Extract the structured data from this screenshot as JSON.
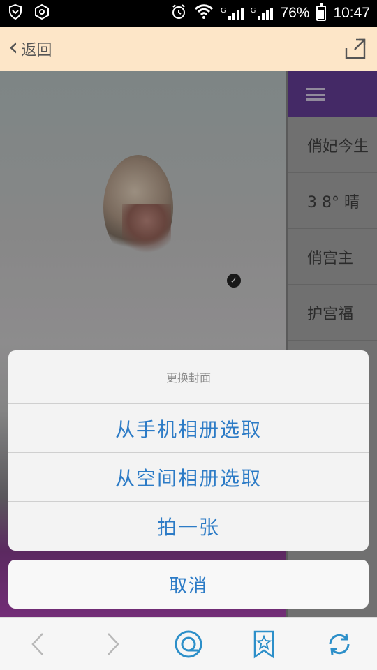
{
  "status_bar": {
    "signal_label_1": "G",
    "signal_label_2": "G",
    "battery": "76%",
    "time": "10:47"
  },
  "header": {
    "back_label": "返回",
    "share_icon": "share-icon"
  },
  "side_menu": {
    "items": [
      {
        "label": "俏妃今生"
      },
      {
        "label": "3 8° 晴"
      },
      {
        "label": "俏宫主"
      },
      {
        "label": "护宫福"
      }
    ]
  },
  "action_sheet": {
    "title": "更换封面",
    "options": [
      {
        "label": "从手机相册选取"
      },
      {
        "label": "从空间相册选取"
      },
      {
        "label": "拍一张"
      }
    ],
    "cancel_label": "取消"
  },
  "bottom_nav": {
    "items": [
      {
        "icon": "back-arrow-icon"
      },
      {
        "icon": "forward-arrow-icon"
      },
      {
        "icon": "qzone-icon"
      },
      {
        "icon": "bookmark-star-icon"
      },
      {
        "icon": "refresh-icon"
      }
    ]
  },
  "colors": {
    "header_bg": "#fde6c8",
    "action_text": "#2c7bc6",
    "menu_bar": "#5f3a8e"
  }
}
